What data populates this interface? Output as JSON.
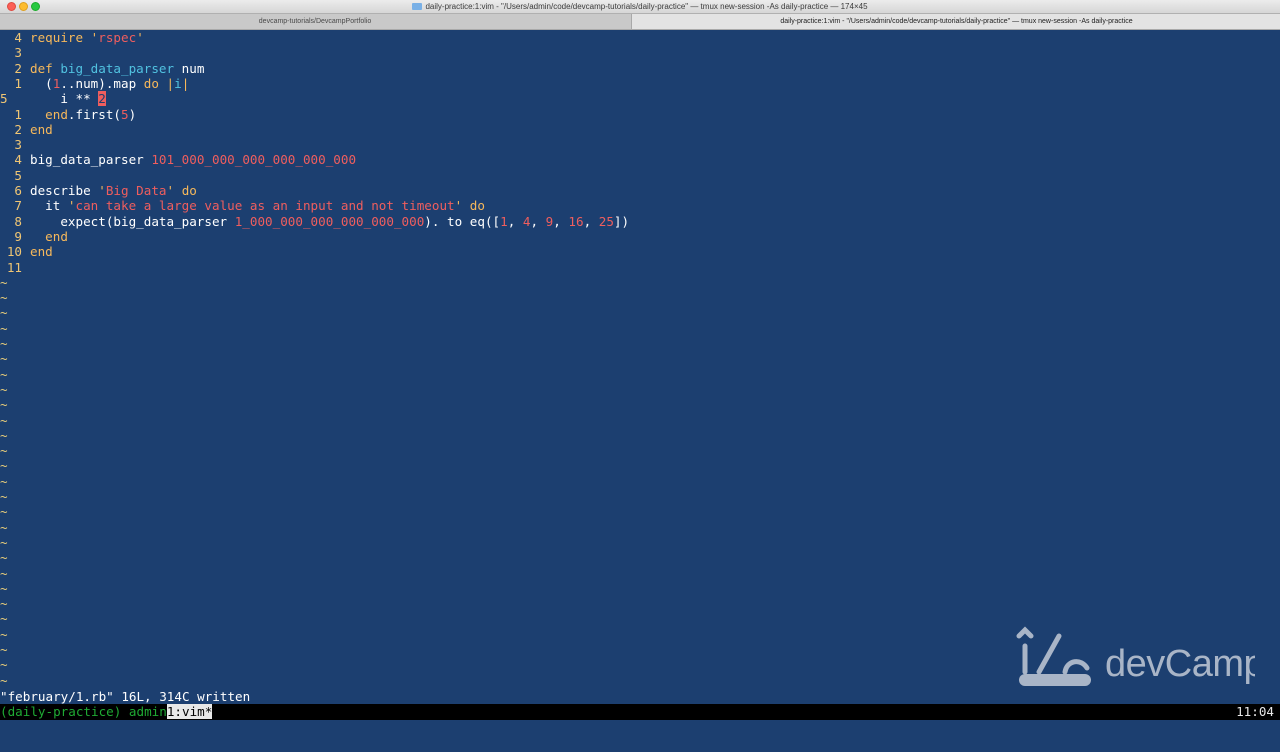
{
  "window": {
    "title": "daily-practice:1:vim - \"/Users/admin/code/devcamp-tutorials/daily-practice\" — tmux new-session -As daily-practice — 174×45",
    "tabs": [
      "devcamp-tutorials/DevcampPortfolio",
      "daily-practice:1:vim - \"/Users/admin/code/devcamp-tutorials/daily-practice\" — tmux new-session -As daily-practice"
    ]
  },
  "editor": {
    "lines": [
      {
        "num": "4",
        "segments": [
          {
            "t": "require ",
            "c": "kw"
          },
          {
            "t": "'",
            "c": "kw"
          },
          {
            "t": "rspec",
            "c": "str"
          },
          {
            "t": "'",
            "c": "kw"
          }
        ]
      },
      {
        "num": "3",
        "segments": []
      },
      {
        "num": "2",
        "segments": [
          {
            "t": "def ",
            "c": "kw"
          },
          {
            "t": "big_data_parser",
            "c": "fn"
          },
          {
            "t": " num",
            "c": "txt"
          }
        ]
      },
      {
        "num": "1",
        "segments": [
          {
            "t": "  (",
            "c": "txt"
          },
          {
            "t": "1",
            "c": "num"
          },
          {
            "t": "..num).map ",
            "c": "txt"
          },
          {
            "t": "do",
            "c": "kw"
          },
          {
            "t": " |",
            "c": "kw"
          },
          {
            "t": "i",
            "c": "fn"
          },
          {
            "t": "|",
            "c": "kw"
          }
        ]
      },
      {
        "num": "5",
        "current": true,
        "segments": [
          {
            "t": "    i ** ",
            "c": "txt"
          },
          {
            "t": "2",
            "c": "cursor"
          }
        ]
      },
      {
        "num": "1",
        "segments": [
          {
            "t": "  ",
            "c": "txt"
          },
          {
            "t": "end",
            "c": "kw"
          },
          {
            "t": ".first(",
            "c": "txt"
          },
          {
            "t": "5",
            "c": "num"
          },
          {
            "t": ")",
            "c": "txt"
          }
        ]
      },
      {
        "num": "2",
        "segments": [
          {
            "t": "end",
            "c": "kw"
          }
        ]
      },
      {
        "num": "3",
        "segments": []
      },
      {
        "num": "4",
        "segments": [
          {
            "t": "big_data_parser ",
            "c": "txt"
          },
          {
            "t": "101_000_000_000_000_000_000",
            "c": "num"
          }
        ]
      },
      {
        "num": "5",
        "segments": []
      },
      {
        "num": "6",
        "segments": [
          {
            "t": "describe ",
            "c": "txt"
          },
          {
            "t": "'",
            "c": "kw"
          },
          {
            "t": "Big Data",
            "c": "str"
          },
          {
            "t": "' ",
            "c": "kw"
          },
          {
            "t": "do",
            "c": "kw"
          }
        ]
      },
      {
        "num": "7",
        "segments": [
          {
            "t": "  it ",
            "c": "txt"
          },
          {
            "t": "'",
            "c": "kw"
          },
          {
            "t": "can take a large value as an input and not timeout",
            "c": "str"
          },
          {
            "t": "' ",
            "c": "kw"
          },
          {
            "t": "do",
            "c": "kw"
          }
        ]
      },
      {
        "num": "8",
        "segments": [
          {
            "t": "    expect(big_data_parser ",
            "c": "txt"
          },
          {
            "t": "1_000_000_000_000_000_000",
            "c": "num"
          },
          {
            "t": "). to eq([",
            "c": "txt"
          },
          {
            "t": "1",
            "c": "num"
          },
          {
            "t": ", ",
            "c": "txt"
          },
          {
            "t": "4",
            "c": "num"
          },
          {
            "t": ", ",
            "c": "txt"
          },
          {
            "t": "9",
            "c": "num"
          },
          {
            "t": ", ",
            "c": "txt"
          },
          {
            "t": "16",
            "c": "num"
          },
          {
            "t": ", ",
            "c": "txt"
          },
          {
            "t": "25",
            "c": "num"
          },
          {
            "t": "])",
            "c": "txt"
          }
        ]
      },
      {
        "num": "9",
        "segments": [
          {
            "t": "  ",
            "c": "txt"
          },
          {
            "t": "end",
            "c": "kw"
          }
        ]
      },
      {
        "num": "10",
        "segments": [
          {
            "t": "end",
            "c": "kw"
          }
        ]
      },
      {
        "num": "11",
        "segments": []
      }
    ],
    "tilde_char": "~",
    "tilde_count": 27
  },
  "message": "\"february/1.rb\" 16L, 314C written",
  "status": {
    "session": "(daily-practice) ",
    "user": "admin",
    "window": "1:vim*",
    "clock": "11:04"
  },
  "watermark": {
    "text": "devCamp",
    "icon": "wrench-hammer-icon"
  },
  "colors": {
    "background": "#1c3f70",
    "keyword": "#f6b85b",
    "function": "#51c2e0",
    "string": "#ef5e5e",
    "line_number": "#f0c674",
    "status_green": "#1faa34"
  }
}
